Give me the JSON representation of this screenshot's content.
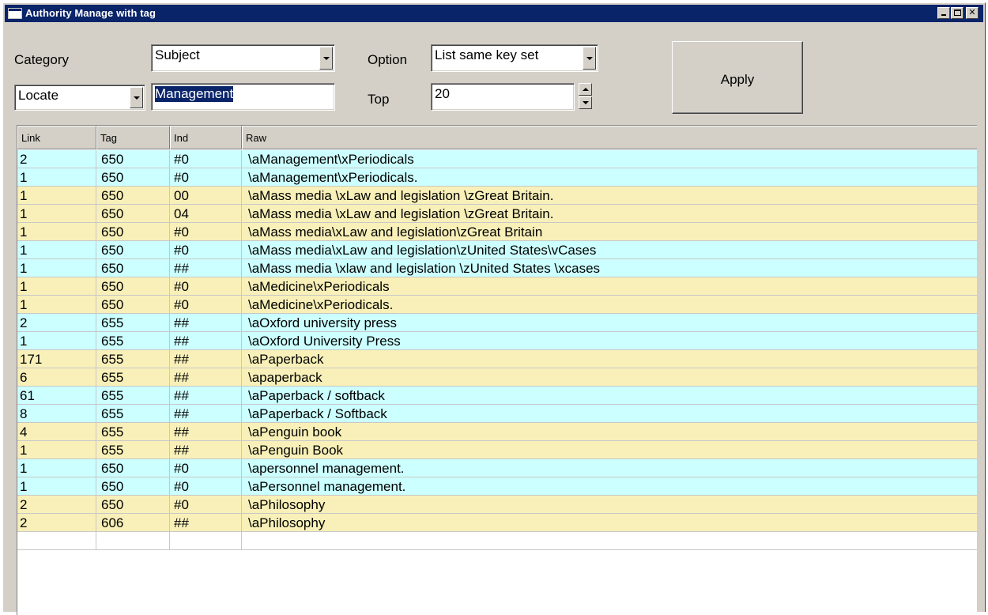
{
  "window": {
    "title": "Authority Manage with tag"
  },
  "form": {
    "category_label": "Category",
    "category_value": "Subject",
    "option_label": "Option",
    "option_value": "List same key set",
    "mode_value": "Locate",
    "search_value": "Management",
    "top_label": "Top",
    "top_value": "20",
    "apply_label": "Apply"
  },
  "grid": {
    "columns": [
      "Link",
      "Tag",
      "Ind",
      "Raw"
    ],
    "rows": [
      {
        "link": "2",
        "tag": "650",
        "ind": "#0",
        "raw": "\\aManagement\\xPeriodicals",
        "color": "cyan"
      },
      {
        "link": "1",
        "tag": "650",
        "ind": "#0",
        "raw": "\\aManagement\\xPeriodicals.",
        "color": "cyan"
      },
      {
        "link": "1",
        "tag": "650",
        "ind": "00",
        "raw": "\\aMass media \\xLaw and legislation \\zGreat Britain.",
        "color": "yellow"
      },
      {
        "link": "1",
        "tag": "650",
        "ind": "04",
        "raw": "\\aMass media \\xLaw and legislation \\zGreat Britain.",
        "color": "yellow"
      },
      {
        "link": "1",
        "tag": "650",
        "ind": "#0",
        "raw": "\\aMass media\\xLaw and legislation\\zGreat Britain",
        "color": "yellow"
      },
      {
        "link": "1",
        "tag": "650",
        "ind": "#0",
        "raw": "\\aMass media\\xLaw and legislation\\zUnited States\\vCases",
        "color": "cyan"
      },
      {
        "link": "1",
        "tag": "650",
        "ind": "##",
        "raw": "\\aMass media \\xlaw and legislation \\zUnited States \\xcases",
        "color": "cyan"
      },
      {
        "link": "1",
        "tag": "650",
        "ind": "#0",
        "raw": "\\aMedicine\\xPeriodicals",
        "color": "yellow"
      },
      {
        "link": "1",
        "tag": "650",
        "ind": "#0",
        "raw": "\\aMedicine\\xPeriodicals.",
        "color": "yellow"
      },
      {
        "link": "2",
        "tag": "655",
        "ind": "##",
        "raw": "\\aOxford university press",
        "color": "cyan"
      },
      {
        "link": "1",
        "tag": "655",
        "ind": "##",
        "raw": "\\aOxford University Press",
        "color": "cyan"
      },
      {
        "link": "171",
        "tag": "655",
        "ind": "##",
        "raw": "\\aPaperback",
        "color": "yellow"
      },
      {
        "link": "6",
        "tag": "655",
        "ind": "##",
        "raw": "\\apaperback",
        "color": "yellow"
      },
      {
        "link": "61",
        "tag": "655",
        "ind": "##",
        "raw": "\\aPaperback / softback",
        "color": "cyan"
      },
      {
        "link": "8",
        "tag": "655",
        "ind": "##",
        "raw": "\\aPaperback / Softback",
        "color": "cyan"
      },
      {
        "link": "4",
        "tag": "655",
        "ind": "##",
        "raw": "\\aPenguin book",
        "color": "yellow"
      },
      {
        "link": "1",
        "tag": "655",
        "ind": "##",
        "raw": "\\aPenguin Book",
        "color": "yellow"
      },
      {
        "link": "1",
        "tag": "650",
        "ind": "#0",
        "raw": "\\apersonnel management.",
        "color": "cyan"
      },
      {
        "link": "1",
        "tag": "650",
        "ind": "#0",
        "raw": "\\aPersonnel management.",
        "color": "cyan"
      },
      {
        "link": "2",
        "tag": "650",
        "ind": "#0",
        "raw": "\\aPhilosophy",
        "color": "yellow"
      },
      {
        "link": "2",
        "tag": "606",
        "ind": "##",
        "raw": "\\aPhilosophy",
        "color": "yellow"
      }
    ]
  },
  "colors": {
    "title_bar": "#0a246a",
    "row_cyan": "#ccffff",
    "row_yellow": "#f8f0b8",
    "face": "#d4d0c8"
  }
}
